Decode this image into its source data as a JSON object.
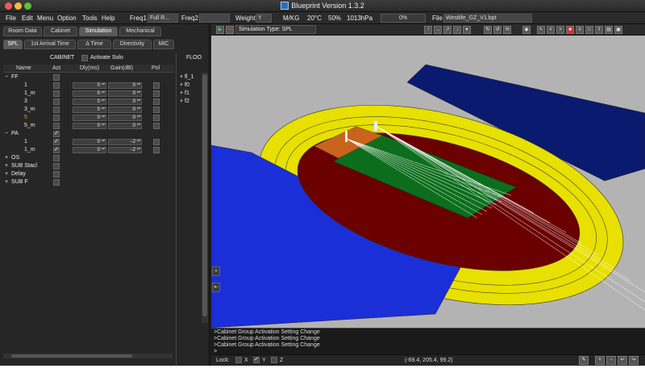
{
  "window": {
    "title": "Blueprint Version 1.3.2"
  },
  "menu": {
    "items": [
      "File",
      "Edit",
      "Menu",
      "Option",
      "Tools",
      "Help"
    ],
    "freq1_label": "Freq1",
    "freq1_value": "Full R...",
    "freq2_label": "Freq2",
    "freq2_value": "",
    "weight_label": "Weight",
    "weight_value": "Y",
    "units": "M/KG",
    "temp": "20°C",
    "humidity": "50%",
    "pressure": "1013hPa",
    "progress": "0%",
    "file_label": "File",
    "file_value": "Westlife_GZ_V1.bpt"
  },
  "tabs_main": [
    "Room Data",
    "Cabinet",
    "Simulation",
    "Mechanical"
  ],
  "tabs_sub": [
    "SPL",
    "1st Arrival Time",
    "Δ Time",
    "Directivity",
    "MIC"
  ],
  "cabinet": {
    "header": "CABINET",
    "activate_solo": "Activate Solo",
    "columns": {
      "name": "Name",
      "act": "Act",
      "dly": "Dly(ms)",
      "gain": "Gain(dB)",
      "pol": "Pol"
    }
  },
  "tree": {
    "groups": [
      {
        "name": "FF",
        "expander": "−"
      },
      {
        "name": "PA",
        "expander": "−"
      },
      {
        "name": "OS",
        "expander": "+"
      },
      {
        "name": "SUB Stacl",
        "expander": "+"
      },
      {
        "name": "Delay",
        "expander": "+"
      },
      {
        "name": "SUB F",
        "expander": "+"
      }
    ],
    "ff_items": [
      {
        "name": "1",
        "dly": "0",
        "gain": "0"
      },
      {
        "name": "1_m",
        "dly": "0",
        "gain": "0"
      },
      {
        "name": "3",
        "dly": "0",
        "gain": "0"
      },
      {
        "name": "3_m",
        "dly": "0",
        "gain": "0"
      },
      {
        "name": "5",
        "dly": "0",
        "gain": "0"
      },
      {
        "name": "5_m",
        "dly": "0",
        "gain": "0"
      }
    ],
    "pa_items": [
      {
        "name": "1",
        "dly": "0",
        "gain": "−2"
      },
      {
        "name": "1_m",
        "dly": "0",
        "gain": "−2"
      }
    ],
    "check_mark": "✓"
  },
  "floor": {
    "header": "FLOO",
    "items": [
      "fl_1",
      "f0",
      "f1",
      "f2"
    ],
    "expander": "+"
  },
  "simulation": {
    "type_label": "Simulation Type: SPL"
  },
  "side_buttons": [
    "»",
    "⇤"
  ],
  "console": {
    "lines": [
      ">Cabinet Group Activation Setting Change",
      ">Cabinet Group Activation Setting Change",
      ">Cabinet Group Activation Setting Change",
      ">"
    ]
  },
  "status": {
    "lock_label": "Lock:",
    "x_label": "X",
    "y_label": "Y",
    "z_label": "Z",
    "coords": "(-69.4, 205.4, 99.2)"
  },
  "colors": {
    "yellow": "#e8e000",
    "navy": "#0a1a6e",
    "blue": "#1a2fd8",
    "maroon": "#6b0000",
    "green": "#0c6e1c",
    "orange": "#c8641e"
  }
}
